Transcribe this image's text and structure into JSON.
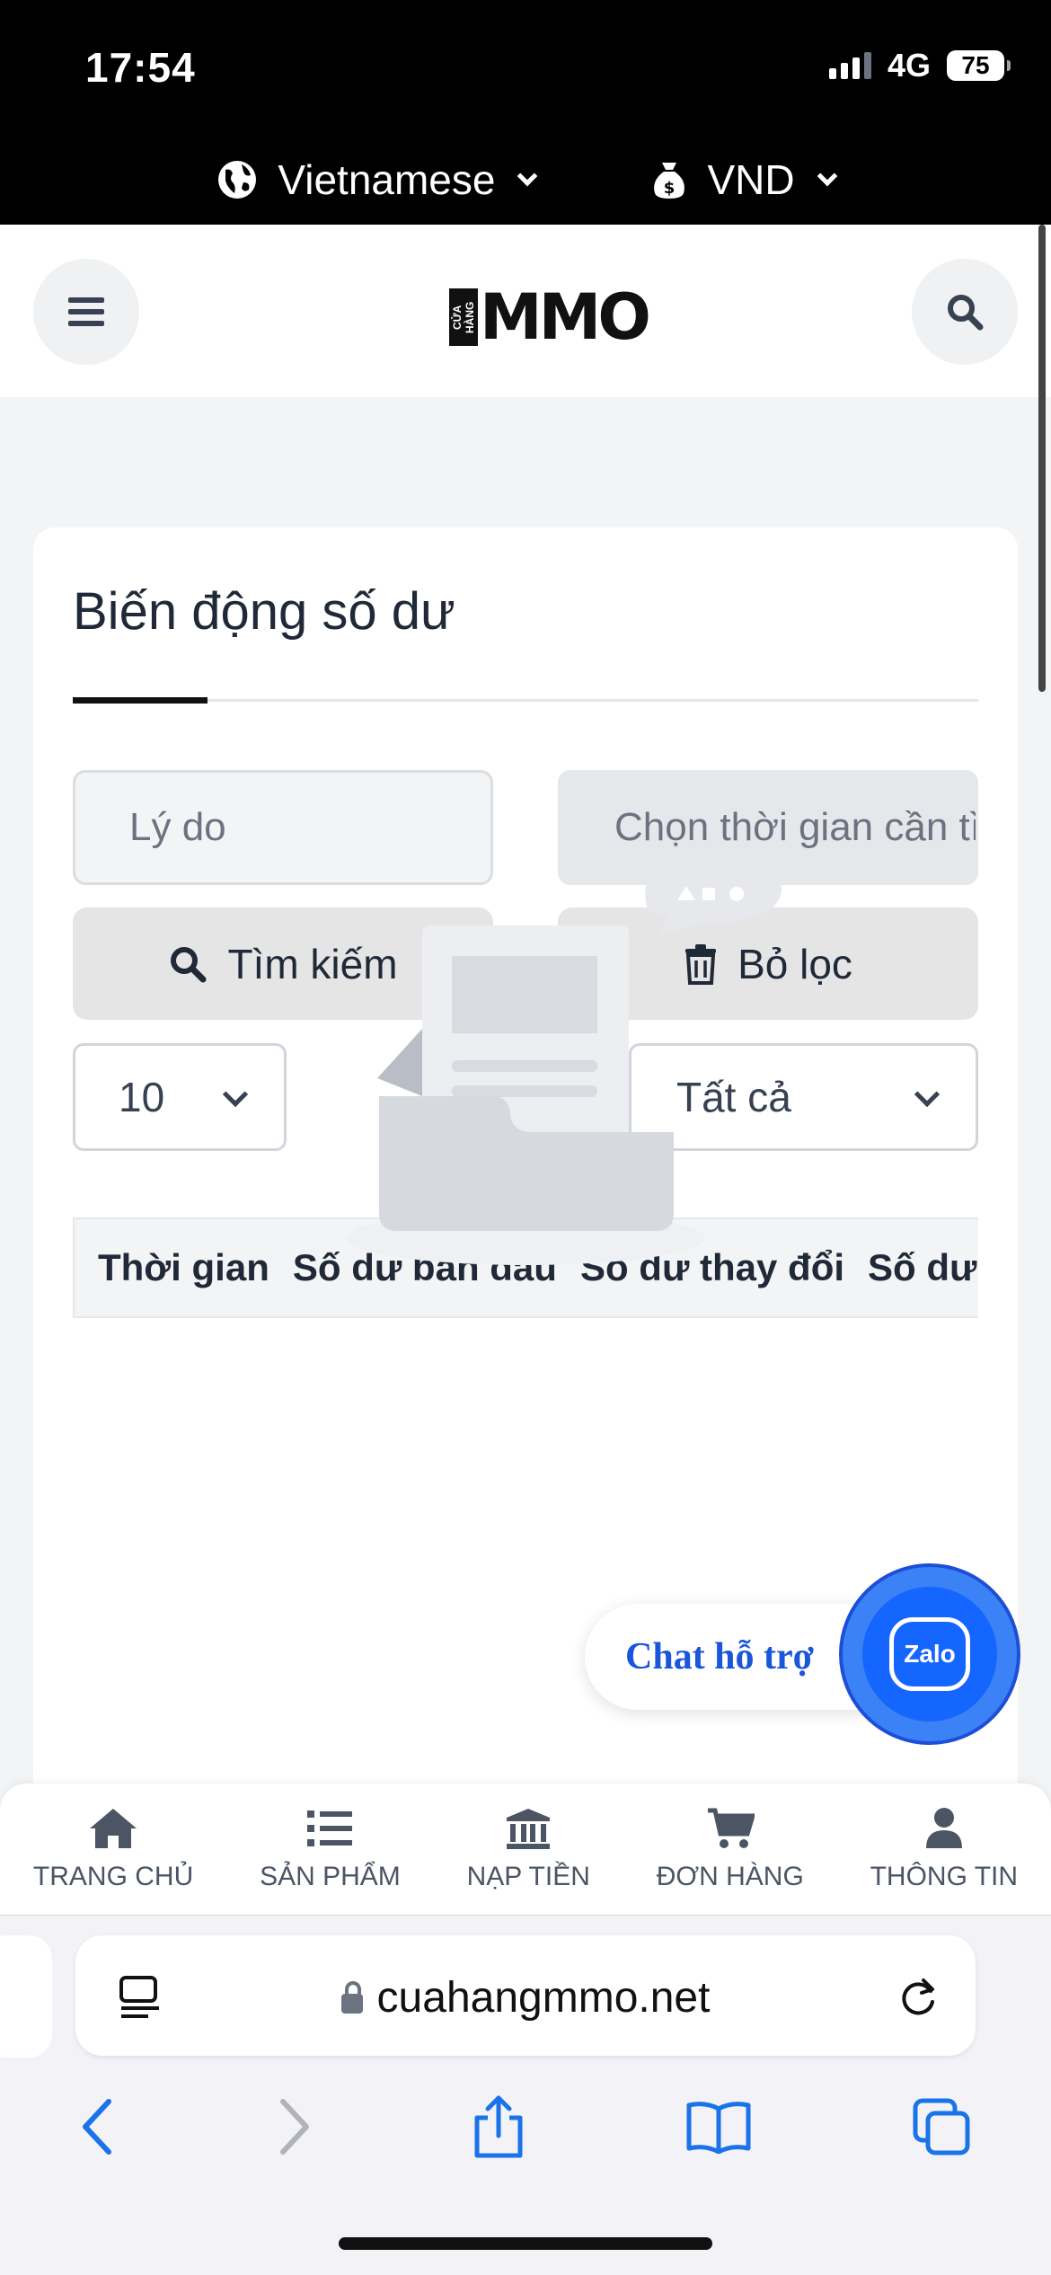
{
  "status": {
    "time": "17:54",
    "network": "4G",
    "battery": "75"
  },
  "topbar": {
    "language": "Vietnamese",
    "currency": "VND"
  },
  "header": {
    "logo_small": "CỬA HÀNG",
    "logo_main": "MMO"
  },
  "page": {
    "title": "Biến động số dư",
    "reason_placeholder": "Lý do",
    "date_placeholder": "Chọn thời gian cần tìm",
    "search_label": "Tìm kiếm",
    "clear_label": "Bỏ lọc",
    "page_size": "10",
    "filter": "Tất cả"
  },
  "table": {
    "headers": [
      "Thời gian",
      "Số dư ban đầu",
      "Số dư thay đổi",
      "Số dư hiện tại"
    ]
  },
  "chat": {
    "label": "Chat hỗ trợ",
    "logo_text": "Zalo"
  },
  "bottom_nav": [
    {
      "label": "TRANG CHỦ",
      "icon": "home-icon"
    },
    {
      "label": "SẢN PHẨM",
      "icon": "list-icon"
    },
    {
      "label": "NẠP TIỀN",
      "icon": "bank-icon"
    },
    {
      "label": "ĐƠN HÀNG",
      "icon": "cart-icon"
    },
    {
      "label": "THÔNG TIN",
      "icon": "user-icon"
    }
  ],
  "browser": {
    "url": "cuahangmmo.net"
  }
}
